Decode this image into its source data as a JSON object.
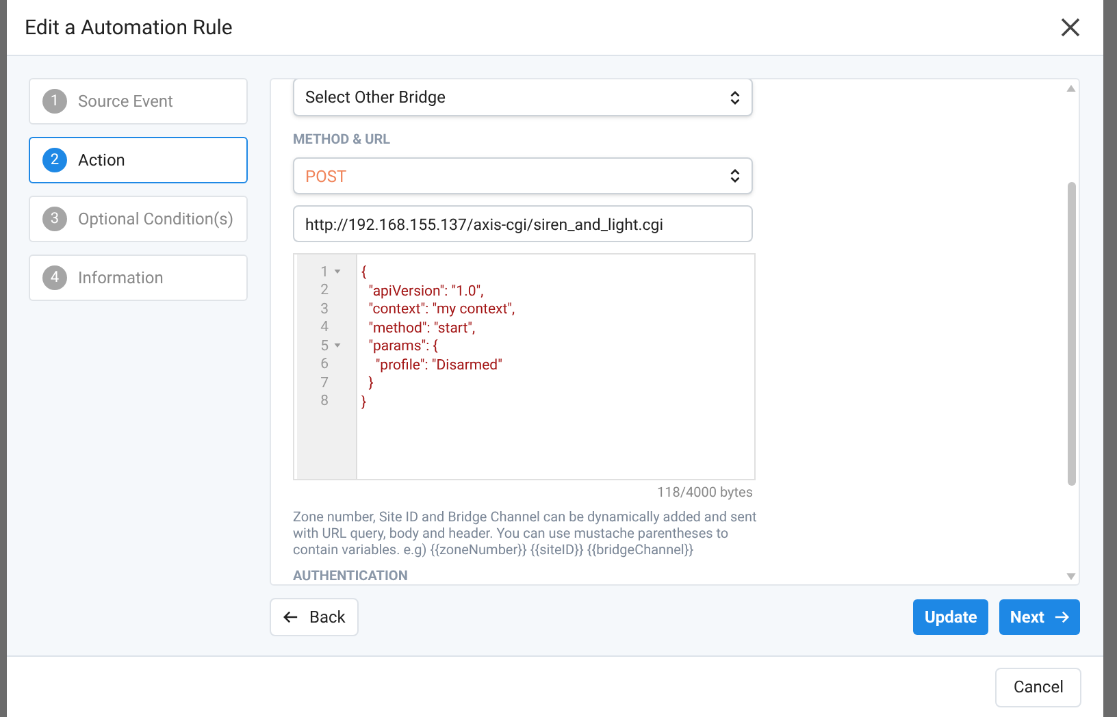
{
  "dialog": {
    "title": "Edit a Automation Rule"
  },
  "steps": [
    {
      "number": "1",
      "label": "Source Event",
      "selected": false
    },
    {
      "number": "2",
      "label": "Action",
      "selected": true
    },
    {
      "number": "3",
      "label": "Optional Condition(s)",
      "selected": false
    },
    {
      "number": "4",
      "label": "Information",
      "selected": false
    }
  ],
  "bridge_select": {
    "value": "Select Other Bridge"
  },
  "method_label": "METHOD & URL",
  "method_select": {
    "value": "POST"
  },
  "url_field": {
    "value": "http://192.168.155.137/axis-cgi/siren_and_light.cgi"
  },
  "editor": {
    "lines": [
      {
        "number": "1",
        "foldable": true,
        "text": "{"
      },
      {
        "number": "2",
        "foldable": false,
        "text": "  \"apiVersion\": \"1.0\","
      },
      {
        "number": "3",
        "foldable": false,
        "text": "  \"context\": \"my context\","
      },
      {
        "number": "4",
        "foldable": false,
        "text": "  \"method\": \"start\","
      },
      {
        "number": "5",
        "foldable": true,
        "text": "  \"params\": {"
      },
      {
        "number": "6",
        "foldable": false,
        "text": "    \"profile\": \"Disarmed\""
      },
      {
        "number": "7",
        "foldable": false,
        "text": "  }"
      },
      {
        "number": "8",
        "foldable": false,
        "text": "}"
      }
    ]
  },
  "byte_count": "118/4000 bytes",
  "help_text": "Zone number, Site ID and Bridge Channel can be dynamically added and sent with URL query, body and header. You can use mustache parentheses to contain variables. e.g) {{zoneNumber}} {{siteID}} {{bridgeChannel}}",
  "auth_label": "AUTHENTICATION",
  "buttons": {
    "back": "Back",
    "update": "Update",
    "next": "Next",
    "cancel": "Cancel"
  }
}
